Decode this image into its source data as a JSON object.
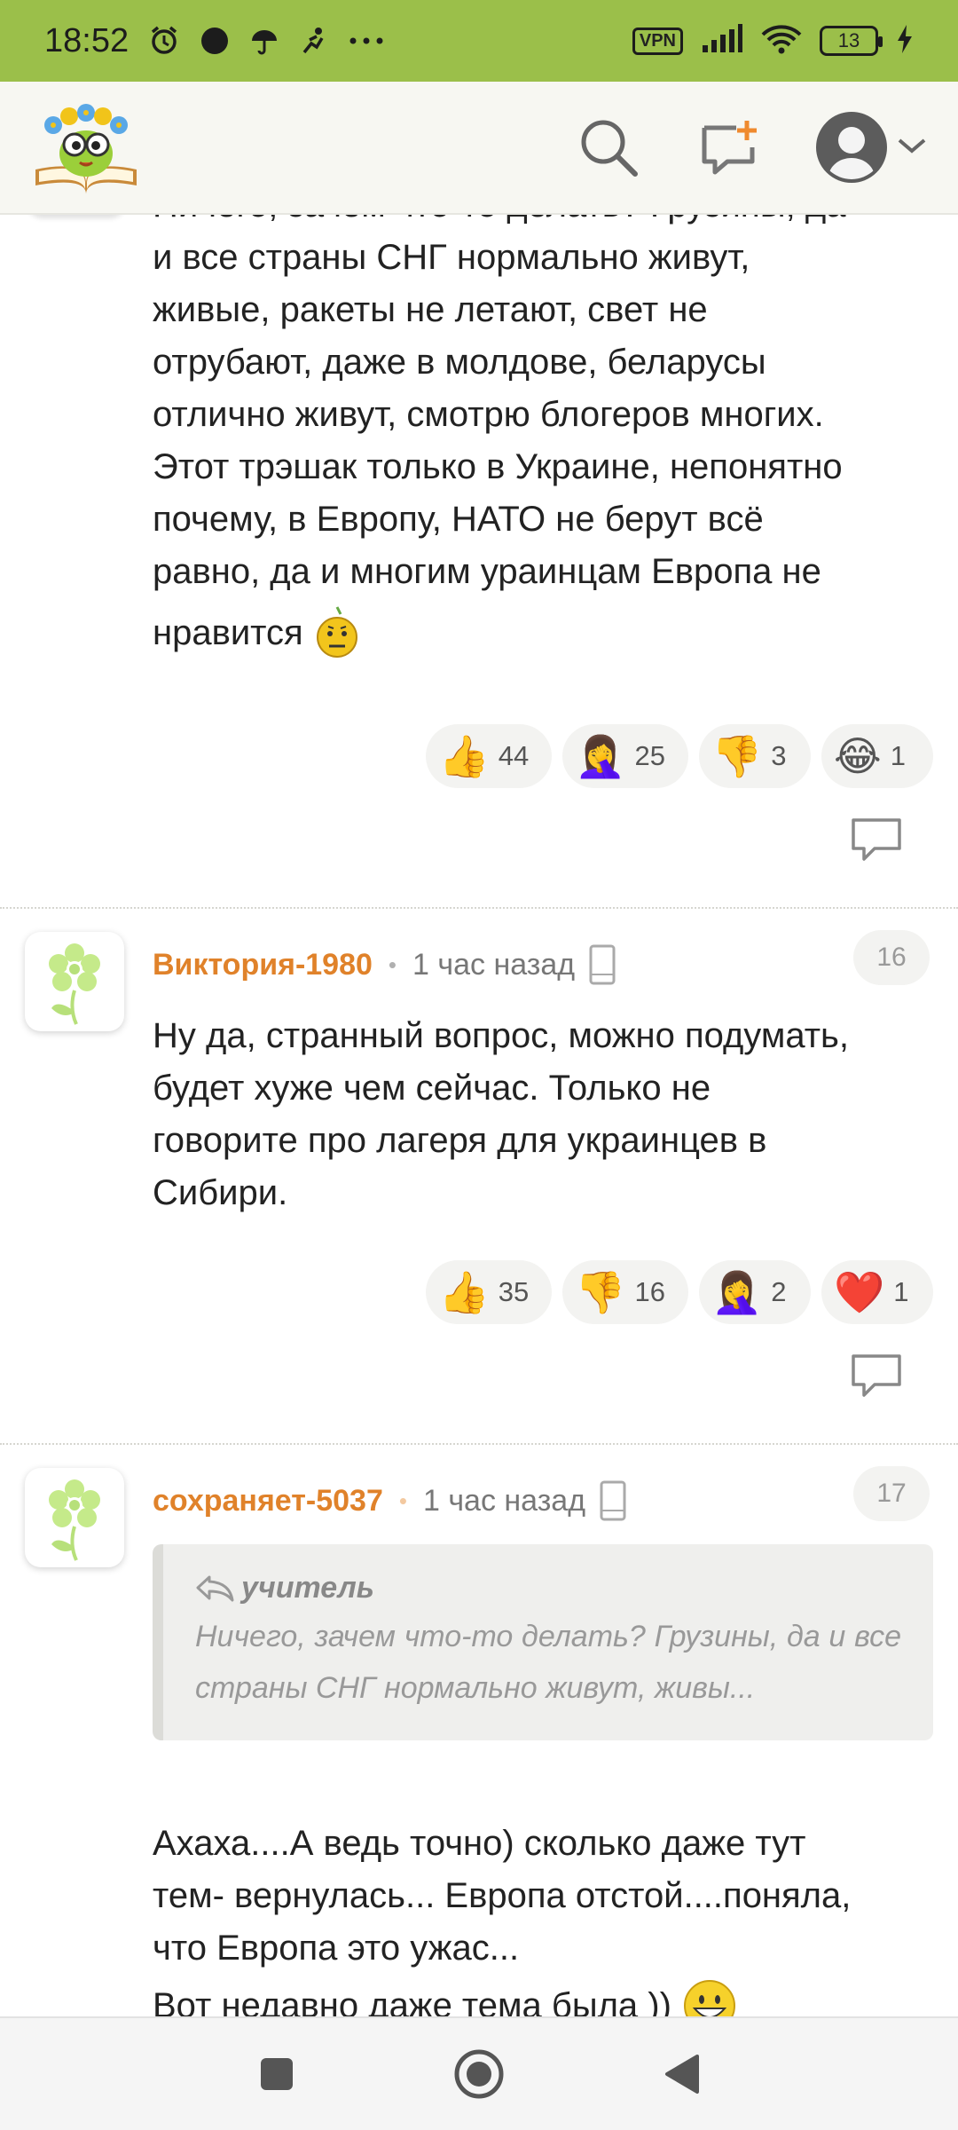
{
  "status_bar": {
    "time": "18:52",
    "icons": [
      "alarm-icon",
      "dnd-icon",
      "weather-icon",
      "activity-icon",
      "more-icon"
    ],
    "vpn": "VPN",
    "battery": "13"
  },
  "header": {
    "logo": "book-owl-logo",
    "icons": [
      "search-icon",
      "new-message-icon",
      "profile-icon",
      "chevron-down-icon"
    ]
  },
  "comments": [
    {
      "text_lines": [
        "Ничего, зачем что-то делать? Грузины, да",
        "и все страны СНГ нормально живут,",
        "живые, ракеты не летают, свет не",
        "отрубают, даже в молдове, беларусы",
        "отлично живут, смотрю блогеров многих.",
        "Этот трэшак только в Украине, непонятно",
        "почему, в Европу, НАТО не берут всё",
        "равно, да и многим ураинцам Европа не",
        "нравится"
      ],
      "reactions": [
        {
          "emoji": "👍",
          "count": "44"
        },
        {
          "emoji": "🤦‍♀️",
          "count": "25"
        },
        {
          "emoji": "👎",
          "count": "3"
        },
        {
          "emoji": "😂",
          "count": "1"
        }
      ]
    },
    {
      "author": "Виктория-1980",
      "time": "1 час назад",
      "number": "16",
      "text_lines": [
        "Ну да, странный вопрос, можно подумать,",
        "будет хуже чем сейчас. Только не",
        "говорите про лагеря для украинцев в",
        "Сибири."
      ],
      "reactions": [
        {
          "emoji": "👍",
          "count": "35"
        },
        {
          "emoji": "👎",
          "count": "16"
        },
        {
          "emoji": "🤦‍♀️",
          "count": "2"
        },
        {
          "emoji": "❤️",
          "count": "1"
        }
      ]
    },
    {
      "author": "сохраняет-5037",
      "time": "1 час назад",
      "number": "17",
      "quote": {
        "author": "учитель",
        "text": "Ничего, зачем что-то делать? Грузины, да и все страны СНГ нормально живут, живы..."
      },
      "text_lines": [
        "Ахаха....А ведь точно) сколько даже тут",
        "тем- вернулась... Европа отстой....поняла,",
        "что Европа это ужас...",
        "Вот недавно даже тема была ))"
      ]
    }
  ],
  "navbar": {
    "icons": [
      "recents-icon",
      "home-icon",
      "back-icon"
    ]
  }
}
